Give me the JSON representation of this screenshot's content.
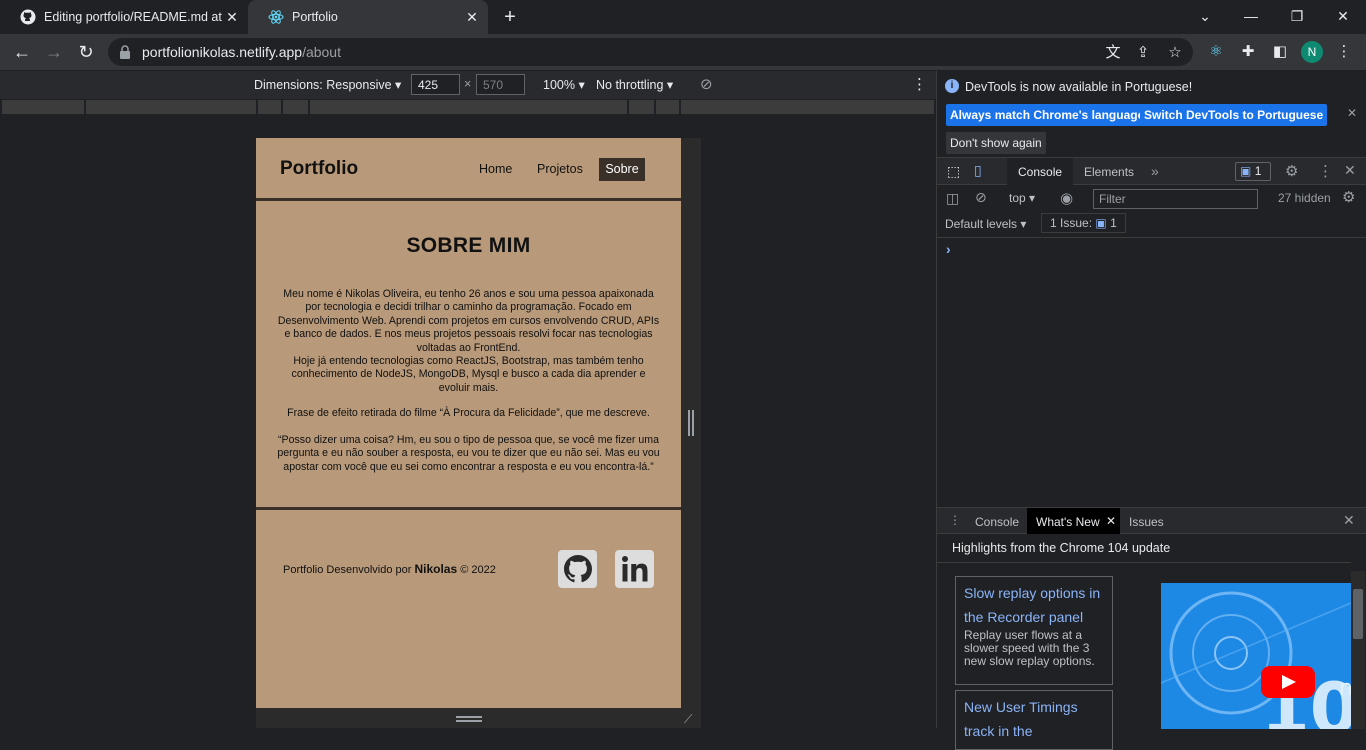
{
  "browser": {
    "tabs": [
      {
        "title": "Editing portfolio/README.md at",
        "icon": "github-icon"
      },
      {
        "title": "Portfolio",
        "icon": "react-icon"
      }
    ],
    "url_main": "portfolionikolas.netlify.app",
    "url_path": "/about",
    "avatar_letter": "N"
  },
  "device_toolbar": {
    "dimensions_label": "Dimensions: Responsive",
    "width": "425",
    "height_placeholder": "570",
    "times": "×",
    "zoom": "100%",
    "throttling": "No throttling"
  },
  "site": {
    "logo": "Portfolio",
    "nav": [
      "Home",
      "Projetos",
      "Sobre"
    ],
    "about_title": "SOBRE MIM",
    "paragraph1": "Meu nome é Nikolas Oliveira, eu tenho 26 anos e sou uma pessoa apaixonada por tecnologia e decidi trilhar o caminho da programação. Focado em Desenvolvimento Web. Aprendi com projetos em cursos envolvendo CRUD, APIs e banco de dados. E nos meus projetos pessoais resolvi focar nas tecnologias voltadas ao FrontEnd.",
    "paragraph2": "Hoje já entendo tecnologias como ReactJS, Bootstrap, mas também tenho conhecimento de NodeJS, MongoDB, Mysql e busco a cada dia aprender e evoluir mais.",
    "paragraph3": "Frase de efeito retirada do filme “À Procura da Felicidade”, que me descreve.",
    "paragraph4": "“Posso dizer uma coisa? Hm, eu sou o tipo de pessoa que, se você me fizer uma pergunta e eu não souber a resposta, eu vou te dizer que eu não sei. Mas eu vou apostar com você que eu sei como encontrar a resposta e eu vou encontra-lá.”",
    "footer_prefix": "Portfolio Desenvolvido por ",
    "footer_name": "Nikolas",
    "footer_suffix": " © 2022"
  },
  "devtools": {
    "info_message": "DevTools is now available in Portuguese!",
    "btn_match": "Always match Chrome's language",
    "btn_switch": "Switch DevTools to Portuguese",
    "btn_dont_show": "Don't show again",
    "tab_console": "Console",
    "tab_elements": "Elements",
    "issue_badge_count": "1",
    "context": "top",
    "filter_placeholder": "Filter",
    "hidden_count": "27 hidden",
    "levels": "Default levels",
    "issues_label": "1 Issue:",
    "issues_count": "1",
    "prompt": "›",
    "drawer_tabs": [
      "Console",
      "What's New",
      "Issues"
    ],
    "highlights": "Highlights from the Chrome 104 update",
    "card1_title": "Slow replay options in the Recorder panel",
    "card1_desc": "Replay user flows at a slower speed with the 3 new slow replay options.",
    "card2_title": "New User Timings track in the"
  },
  "colors": {
    "site_bg": "#b89979",
    "site_dark": "#3a302a",
    "accent_blue": "#1a73e8",
    "link_blue": "#8ab4f8"
  }
}
